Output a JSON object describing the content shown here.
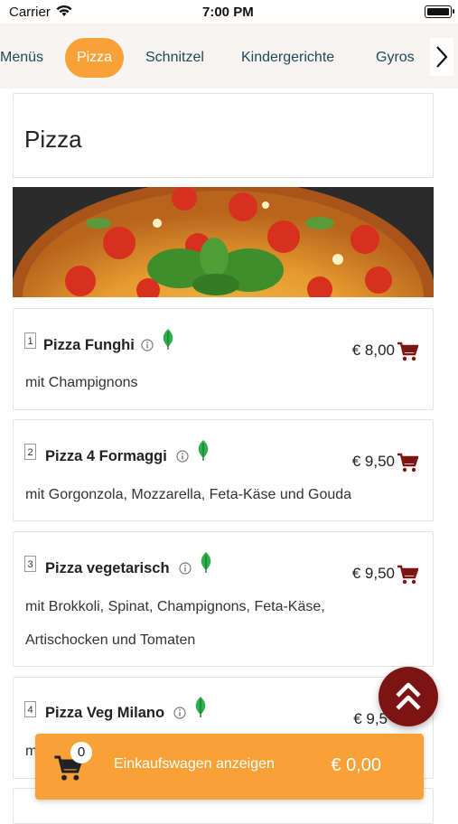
{
  "status_bar": {
    "carrier": "Carrier",
    "time": "7:00 PM"
  },
  "tabs": [
    {
      "label": "Menüs",
      "active": false
    },
    {
      "label": "Pizza",
      "active": true
    },
    {
      "label": "Schnitzel",
      "active": false
    },
    {
      "label": "Kindergerichte",
      "active": false
    },
    {
      "label": "Gyros",
      "active": false
    }
  ],
  "section": {
    "title": "Pizza"
  },
  "items": [
    {
      "number": "1",
      "name": "Pizza Funghi",
      "price": "€ 8,00",
      "description": "mit Champignons",
      "vegetarian": true
    },
    {
      "number": "2",
      "name": "Pizza 4 Formaggi",
      "price": "€ 9,50",
      "description": "mit Gorgonzola, Mozzarella, Feta-Käse und Gouda",
      "vegetarian": true
    },
    {
      "number": "3",
      "name": "Pizza vegetarisch",
      "price": "€ 9,50",
      "description": "mit Brokkoli, Spinat, Champignons, Feta-Käse, Artischocken und Tomaten",
      "vegetarian": true
    },
    {
      "number": "4",
      "name": "Pizza Veg Milano",
      "price": "€ 9,5",
      "description": "m",
      "vegetarian": true
    }
  ],
  "cart": {
    "count": "0",
    "label": "Einkaufswagen anzeigen",
    "total": "€ 0,00"
  },
  "colors": {
    "accent": "#f7a136",
    "tab_text": "#1e4a56",
    "cart_icon": "#7d1414",
    "leaf": "#2fae4e",
    "scroll_top_bg": "#7d1414"
  },
  "icons": {
    "wifi": "wifi-icon",
    "next": "chevron-right-icon",
    "info": "info-icon",
    "leaf": "leaf-icon",
    "cart": "shopping-cart-icon",
    "scroll_top": "double-chevron-up-icon"
  }
}
